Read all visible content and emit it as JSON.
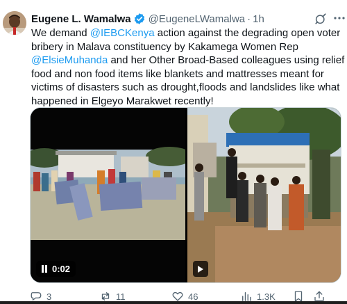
{
  "tweet": {
    "author_name": "Eugene L. Wamalwa",
    "handle": "@EugeneLWamalwa",
    "separator": "·",
    "time": "1h",
    "text_parts": {
      "p1": "We demand ",
      "m1": "@IEBCKenya",
      "p2": " action against the degrading open voter bribery in Malava constituency by Kakamega Women Rep ",
      "m2": "@ElsieMuhanda",
      "p3": " and her Other Broad-Based colleagues using relief food and non food items like blankets and mattresses meant for victims of disasters such as drought,floods and landslides like what happened in Elgeyo Marakwet recently!"
    },
    "video_time": "0:02",
    "counts": {
      "replies": "3",
      "reposts": "11",
      "likes": "46",
      "views": "1.3K"
    }
  },
  "icons": {
    "verified": "verified-badge-icon",
    "grok": "grok-icon",
    "more": "more-icon",
    "reply": "reply-icon",
    "repost": "repost-icon",
    "like": "heart-icon",
    "views": "views-icon",
    "bookmark": "bookmark-icon",
    "share": "share-icon",
    "pause": "pause-icon",
    "play": "play-icon"
  },
  "colors": {
    "link": "#1d9bf0",
    "secondary_text": "#536471",
    "verified": "#1d9bf0"
  }
}
